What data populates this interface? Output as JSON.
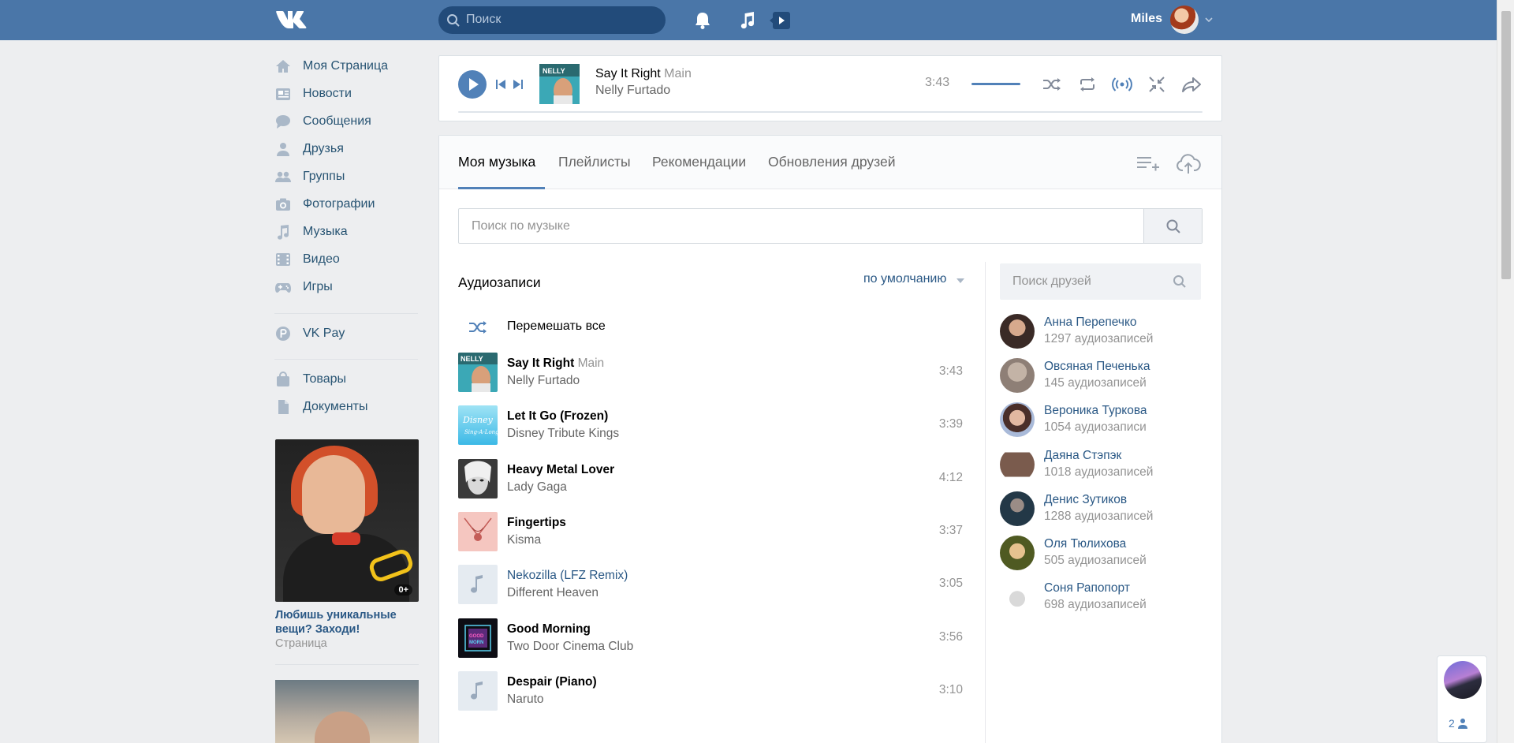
{
  "header": {
    "search_placeholder": "Поиск",
    "user_name": "Miles"
  },
  "nav": {
    "items": [
      {
        "label": "Моя Страница",
        "icon": "home-icon"
      },
      {
        "label": "Новости",
        "icon": "news-icon"
      },
      {
        "label": "Сообщения",
        "icon": "messages-icon"
      },
      {
        "label": "Друзья",
        "icon": "friends-icon"
      },
      {
        "label": "Группы",
        "icon": "groups-icon"
      },
      {
        "label": "Фотографии",
        "icon": "camera-icon"
      },
      {
        "label": "Музыка",
        "icon": "music-note-icon"
      },
      {
        "label": "Видео",
        "icon": "film-icon"
      },
      {
        "label": "Игры",
        "icon": "gamepad-icon"
      }
    ],
    "pay": {
      "label": "VK Pay",
      "icon": "vkpay-icon"
    },
    "extra": [
      {
        "label": "Товары",
        "icon": "bag-icon"
      },
      {
        "label": "Документы",
        "icon": "document-icon"
      }
    ]
  },
  "promo": {
    "age_badge": "0+",
    "title": "Любишь уникальные вещи? Заходи!",
    "subtitle": "Страница"
  },
  "player": {
    "title": "Say It Right",
    "subtitle": "Main",
    "artist": "Nelly Furtado",
    "time": "3:43",
    "volume_fraction": 1.0,
    "progress_fraction": 0.0
  },
  "tabs": [
    {
      "label": "Моя музыка",
      "active": true
    },
    {
      "label": "Плейлисты",
      "active": false
    },
    {
      "label": "Рекомендации",
      "active": false
    },
    {
      "label": "Обновления друзей",
      "active": false
    }
  ],
  "music_search_placeholder": "Поиск по музыке",
  "audio": {
    "section_title": "Аудиозаписи",
    "sort_label": "по умолчанию",
    "shuffle_label": "Перемешать все",
    "tracks": [
      {
        "title": "Say It Right",
        "subtitle": "Main",
        "artist": "Nelly Furtado",
        "duration": "3:43",
        "cover": "nelly"
      },
      {
        "title": "Let It Go (Frozen)",
        "subtitle": "",
        "artist": "Disney Tribute Kings",
        "duration": "3:39",
        "cover": "disney"
      },
      {
        "title": "Heavy Metal Lover",
        "subtitle": "",
        "artist": "Lady Gaga",
        "duration": "4:12",
        "cover": "gaga"
      },
      {
        "title": "Fingertips",
        "subtitle": "",
        "artist": "Kisma",
        "duration": "3:37",
        "cover": "kisma"
      },
      {
        "title": "Nekozilla (LFZ Remix)",
        "subtitle": "",
        "artist": "Different Heaven",
        "duration": "3:05",
        "cover": "note"
      },
      {
        "title": "Good Morning",
        "subtitle": "",
        "artist": "Two Door Cinema Club",
        "duration": "3:56",
        "cover": "tdcc"
      },
      {
        "title": "Despair (Piano)",
        "subtitle": "",
        "artist": "Naruto",
        "duration": "3:10",
        "cover": "note"
      }
    ]
  },
  "friends": {
    "search_placeholder": "Поиск друзей",
    "list": [
      {
        "name": "Анна Перепечко",
        "count": "1297 аудиозаписей"
      },
      {
        "name": "Овсяная Печенька",
        "count": "145 аудиозаписей"
      },
      {
        "name": "Вероника Туркова",
        "count": "1054 аудиозаписи"
      },
      {
        "name": "Даяна Стэпэк",
        "count": "1018 аудиозаписей"
      },
      {
        "name": "Денис Зутиков",
        "count": "1288 аудиозаписей"
      },
      {
        "name": "Оля Тюлихова",
        "count": "505 аудиозаписей"
      },
      {
        "name": "Соня Рапопорт",
        "count": "698 аудиозаписей"
      }
    ]
  },
  "chat_widget": {
    "count": "2"
  },
  "colors": {
    "header": "#4a76a8",
    "accent": "#5181b8",
    "link": "#2a5885"
  }
}
